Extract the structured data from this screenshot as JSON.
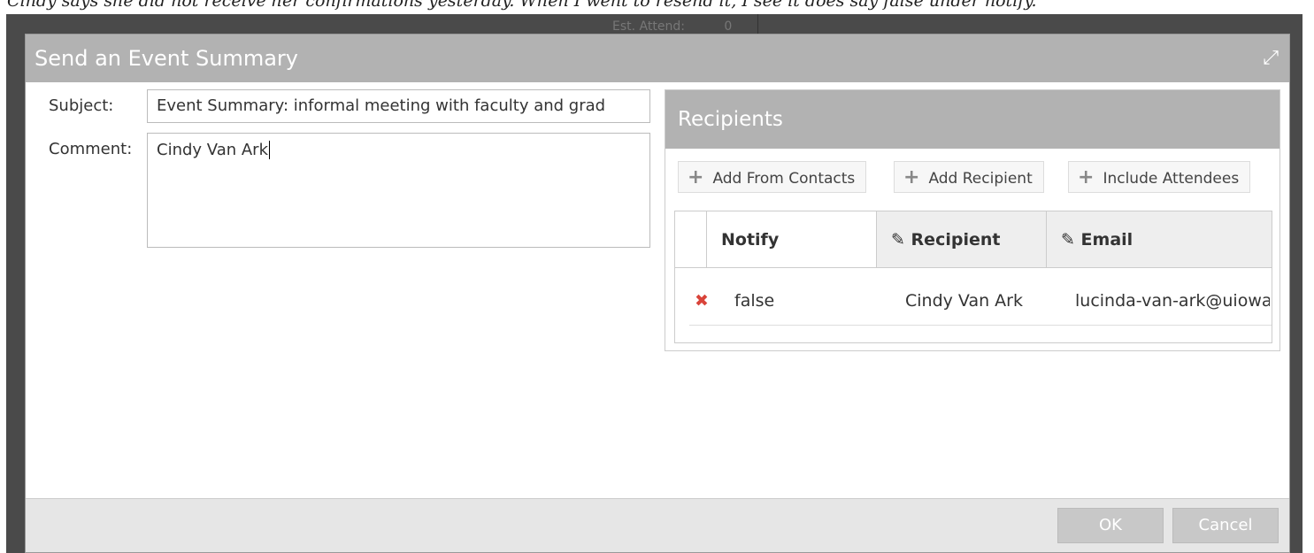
{
  "note": "Cindy says she did not receive her confirmations yesterday.  When I went to resend it, I see it does say false under notify.",
  "background": {
    "field_label": "Est. Attend:",
    "field_value": "0"
  },
  "dialog": {
    "title": "Send an Event Summary",
    "subject_label": "Subject:",
    "subject_value": "Event Summary: informal meeting with faculty and grad",
    "comment_label": "Comment:",
    "comment_value": "Cindy Van Ark",
    "recipients": {
      "title": "Recipients",
      "buttons": [
        "Add From Contacts",
        "Add Recipient",
        "Include Attendees"
      ],
      "columns": [
        "Notify",
        "Recipient",
        "Email"
      ],
      "rows": [
        {
          "notify": "false",
          "recipient": "Cindy Van Ark",
          "email": "lucinda-van-ark@uiowa"
        }
      ]
    },
    "ok": "OK",
    "cancel": "Cancel"
  }
}
